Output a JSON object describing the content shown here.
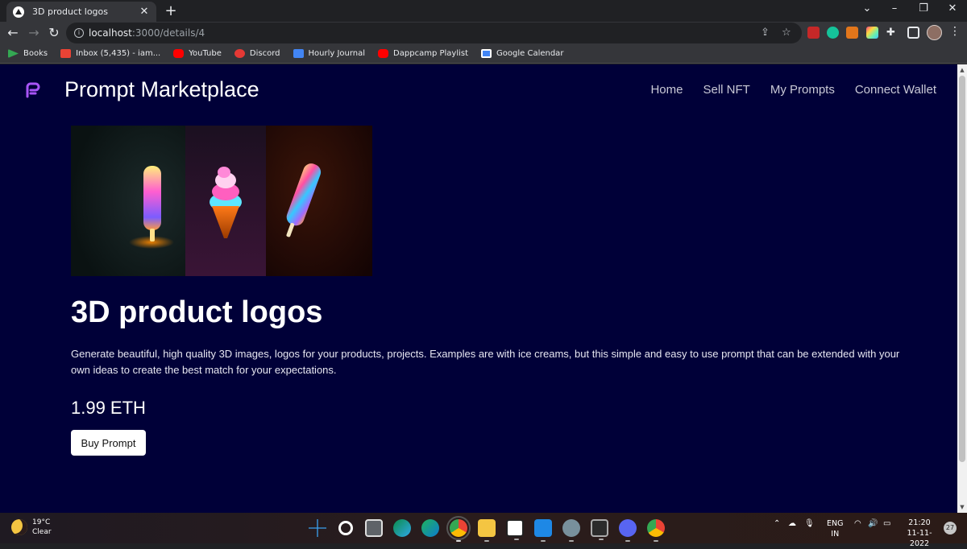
{
  "browser": {
    "tab_title": "3D product logos",
    "url_host": "localhost",
    "url_path": ":3000/details/4",
    "bookmarks": [
      {
        "label": "Books",
        "icon": "play-books-icon",
        "color": "#34a853"
      },
      {
        "label": "Inbox (5,435) - iam...",
        "icon": "gmail-icon",
        "color": "#ea4335"
      },
      {
        "label": "YouTube",
        "icon": "youtube-icon",
        "color": "#ff0000"
      },
      {
        "label": "Discord",
        "icon": "discord-icon",
        "color": "#e53935"
      },
      {
        "label": "Hourly Journal",
        "icon": "docs-icon",
        "color": "#4285f4"
      },
      {
        "label": "Dappcamp Playlist",
        "icon": "youtube-icon",
        "color": "#ff0000"
      },
      {
        "label": "Google Calendar",
        "icon": "calendar-icon",
        "color": "#4285f4"
      }
    ]
  },
  "site": {
    "brand": "Prompt Marketplace",
    "nav": [
      "Home",
      "Sell NFT",
      "My Prompts",
      "Connect Wallet"
    ]
  },
  "product": {
    "title": "3D product logos",
    "description": "Generate beautiful, high quality 3D images, logos for your products, projects. Examples are with ice creams, but this simple and easy to use prompt that can be extended with your own ideas to create the best match for your expectations.",
    "price": "1.99 ETH",
    "buy_label": "Buy Prompt"
  },
  "taskbar": {
    "temperature": "19°C",
    "weather": "Clear",
    "lang_top": "ENG",
    "lang_bottom": "IN",
    "time": "21:20",
    "date": "11-11-2022",
    "notifications": "27"
  },
  "colors": {
    "page_bg": "#000038",
    "accent": "#a855f7"
  }
}
